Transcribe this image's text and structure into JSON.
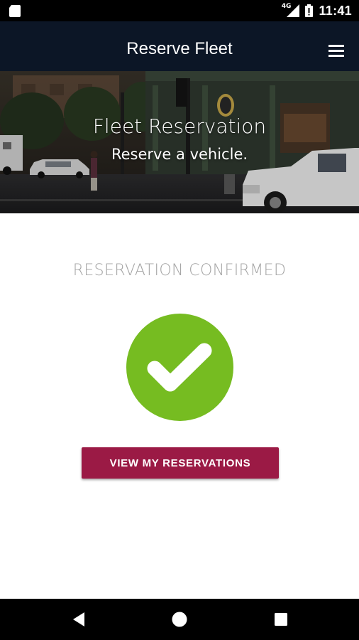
{
  "status_bar": {
    "network_type": "4G",
    "time": "11:41",
    "icons": [
      "sd-card-icon",
      "signal-icon",
      "battery-icon"
    ]
  },
  "app_bar": {
    "title": "Reserve Fleet",
    "menu_icon": "hamburger-menu-icon"
  },
  "hero": {
    "title": "Fleet Reservation",
    "subtitle": "Reserve a vehicle."
  },
  "confirmation": {
    "heading": "RESERVATION CONFIRMED",
    "icon": "checkmark-circle-icon",
    "icon_color": "#76bc21",
    "button_label": "VIEW MY RESERVATIONS",
    "button_color": "#9b1a45"
  },
  "nav_bar": {
    "buttons": [
      "back-icon",
      "home-icon",
      "recents-icon"
    ]
  },
  "colors": {
    "app_bar": "#0c1626",
    "accent": "#9b1a45",
    "success": "#76bc21",
    "heading_text": "#a4a4a4"
  }
}
